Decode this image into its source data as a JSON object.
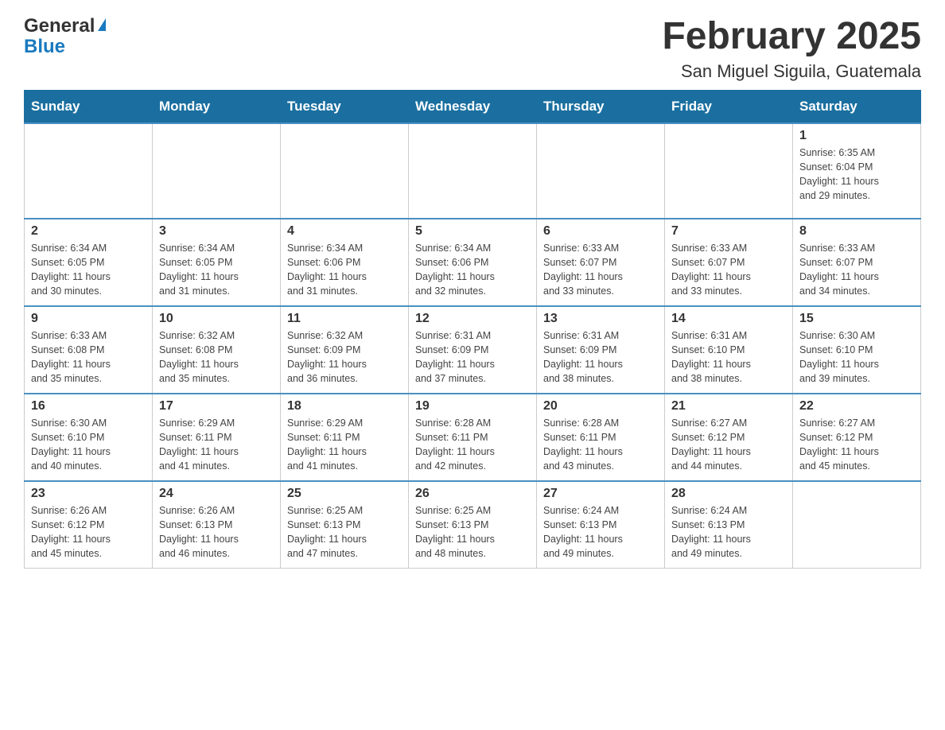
{
  "header": {
    "logo_general": "General",
    "logo_blue": "Blue",
    "month_title": "February 2025",
    "location": "San Miguel Siguila, Guatemala"
  },
  "days_of_week": [
    "Sunday",
    "Monday",
    "Tuesday",
    "Wednesday",
    "Thursday",
    "Friday",
    "Saturday"
  ],
  "weeks": [
    [
      {
        "day": "",
        "info": ""
      },
      {
        "day": "",
        "info": ""
      },
      {
        "day": "",
        "info": ""
      },
      {
        "day": "",
        "info": ""
      },
      {
        "day": "",
        "info": ""
      },
      {
        "day": "",
        "info": ""
      },
      {
        "day": "1",
        "info": "Sunrise: 6:35 AM\nSunset: 6:04 PM\nDaylight: 11 hours\nand 29 minutes."
      }
    ],
    [
      {
        "day": "2",
        "info": "Sunrise: 6:34 AM\nSunset: 6:05 PM\nDaylight: 11 hours\nand 30 minutes."
      },
      {
        "day": "3",
        "info": "Sunrise: 6:34 AM\nSunset: 6:05 PM\nDaylight: 11 hours\nand 31 minutes."
      },
      {
        "day": "4",
        "info": "Sunrise: 6:34 AM\nSunset: 6:06 PM\nDaylight: 11 hours\nand 31 minutes."
      },
      {
        "day": "5",
        "info": "Sunrise: 6:34 AM\nSunset: 6:06 PM\nDaylight: 11 hours\nand 32 minutes."
      },
      {
        "day": "6",
        "info": "Sunrise: 6:33 AM\nSunset: 6:07 PM\nDaylight: 11 hours\nand 33 minutes."
      },
      {
        "day": "7",
        "info": "Sunrise: 6:33 AM\nSunset: 6:07 PM\nDaylight: 11 hours\nand 33 minutes."
      },
      {
        "day": "8",
        "info": "Sunrise: 6:33 AM\nSunset: 6:07 PM\nDaylight: 11 hours\nand 34 minutes."
      }
    ],
    [
      {
        "day": "9",
        "info": "Sunrise: 6:33 AM\nSunset: 6:08 PM\nDaylight: 11 hours\nand 35 minutes."
      },
      {
        "day": "10",
        "info": "Sunrise: 6:32 AM\nSunset: 6:08 PM\nDaylight: 11 hours\nand 35 minutes."
      },
      {
        "day": "11",
        "info": "Sunrise: 6:32 AM\nSunset: 6:09 PM\nDaylight: 11 hours\nand 36 minutes."
      },
      {
        "day": "12",
        "info": "Sunrise: 6:31 AM\nSunset: 6:09 PM\nDaylight: 11 hours\nand 37 minutes."
      },
      {
        "day": "13",
        "info": "Sunrise: 6:31 AM\nSunset: 6:09 PM\nDaylight: 11 hours\nand 38 minutes."
      },
      {
        "day": "14",
        "info": "Sunrise: 6:31 AM\nSunset: 6:10 PM\nDaylight: 11 hours\nand 38 minutes."
      },
      {
        "day": "15",
        "info": "Sunrise: 6:30 AM\nSunset: 6:10 PM\nDaylight: 11 hours\nand 39 minutes."
      }
    ],
    [
      {
        "day": "16",
        "info": "Sunrise: 6:30 AM\nSunset: 6:10 PM\nDaylight: 11 hours\nand 40 minutes."
      },
      {
        "day": "17",
        "info": "Sunrise: 6:29 AM\nSunset: 6:11 PM\nDaylight: 11 hours\nand 41 minutes."
      },
      {
        "day": "18",
        "info": "Sunrise: 6:29 AM\nSunset: 6:11 PM\nDaylight: 11 hours\nand 41 minutes."
      },
      {
        "day": "19",
        "info": "Sunrise: 6:28 AM\nSunset: 6:11 PM\nDaylight: 11 hours\nand 42 minutes."
      },
      {
        "day": "20",
        "info": "Sunrise: 6:28 AM\nSunset: 6:11 PM\nDaylight: 11 hours\nand 43 minutes."
      },
      {
        "day": "21",
        "info": "Sunrise: 6:27 AM\nSunset: 6:12 PM\nDaylight: 11 hours\nand 44 minutes."
      },
      {
        "day": "22",
        "info": "Sunrise: 6:27 AM\nSunset: 6:12 PM\nDaylight: 11 hours\nand 45 minutes."
      }
    ],
    [
      {
        "day": "23",
        "info": "Sunrise: 6:26 AM\nSunset: 6:12 PM\nDaylight: 11 hours\nand 45 minutes."
      },
      {
        "day": "24",
        "info": "Sunrise: 6:26 AM\nSunset: 6:13 PM\nDaylight: 11 hours\nand 46 minutes."
      },
      {
        "day": "25",
        "info": "Sunrise: 6:25 AM\nSunset: 6:13 PM\nDaylight: 11 hours\nand 47 minutes."
      },
      {
        "day": "26",
        "info": "Sunrise: 6:25 AM\nSunset: 6:13 PM\nDaylight: 11 hours\nand 48 minutes."
      },
      {
        "day": "27",
        "info": "Sunrise: 6:24 AM\nSunset: 6:13 PM\nDaylight: 11 hours\nand 49 minutes."
      },
      {
        "day": "28",
        "info": "Sunrise: 6:24 AM\nSunset: 6:13 PM\nDaylight: 11 hours\nand 49 minutes."
      },
      {
        "day": "",
        "info": ""
      }
    ]
  ]
}
